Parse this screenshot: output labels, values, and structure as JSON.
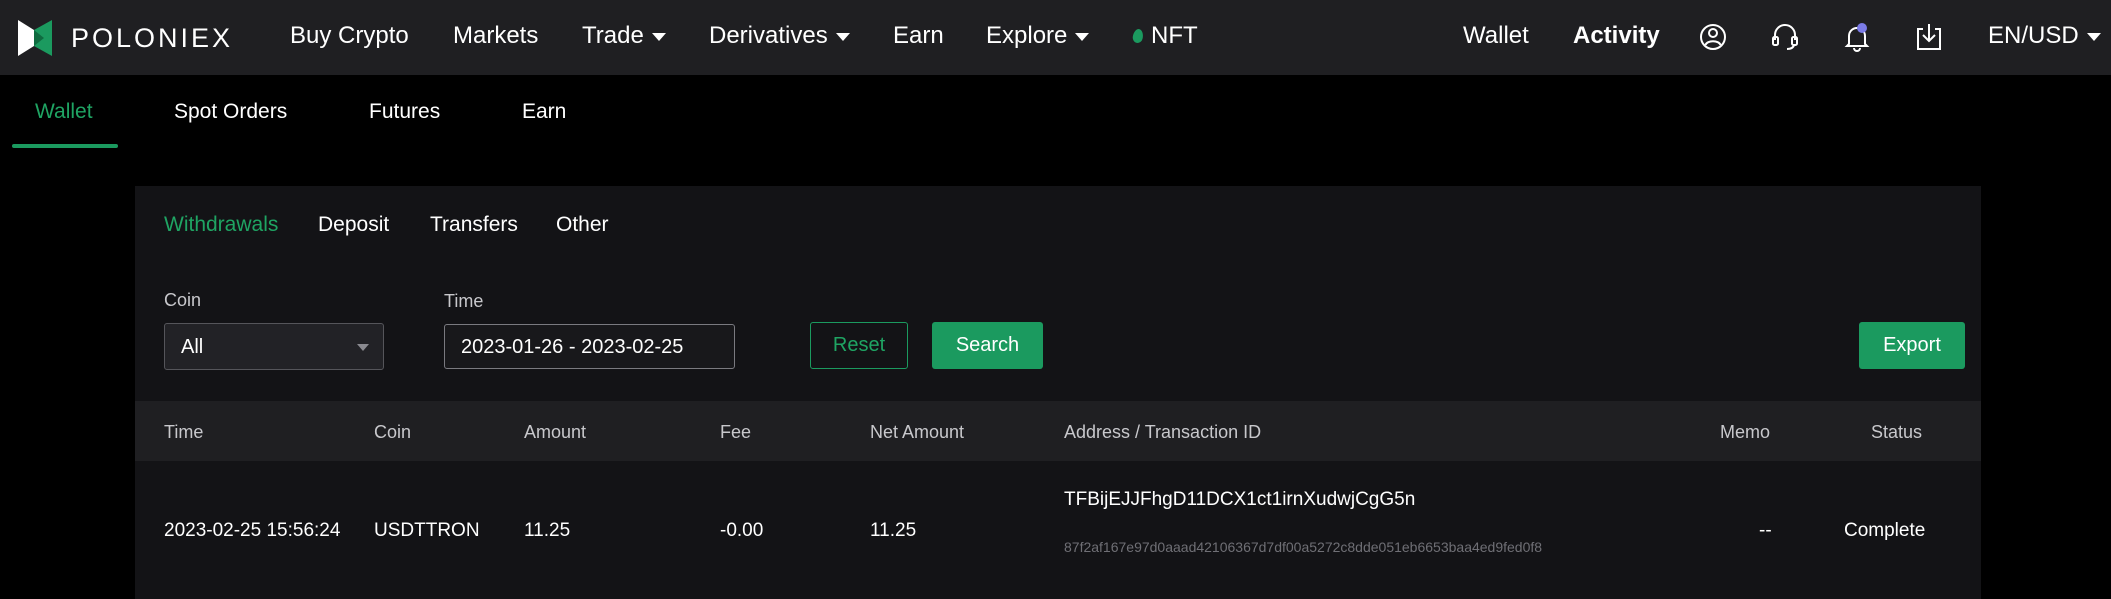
{
  "brand": {
    "name": "POLONIEX"
  },
  "topnav": {
    "items": [
      {
        "label": "Buy Crypto",
        "caret": false
      },
      {
        "label": "Markets",
        "caret": false
      },
      {
        "label": "Trade",
        "caret": true
      },
      {
        "label": "Derivatives",
        "caret": true
      },
      {
        "label": "Earn",
        "caret": false
      },
      {
        "label": "Explore",
        "caret": true
      },
      {
        "label": "NFT",
        "caret": false
      }
    ],
    "wallet": "Wallet",
    "activity": "Activity",
    "locale": "EN/USD",
    "icons": [
      "user-icon",
      "headset-icon",
      "bell-icon",
      "download-icon"
    ],
    "accent": "#1b9a5f"
  },
  "subnav": {
    "items": [
      "Wallet",
      "Spot Orders",
      "Futures",
      "Earn"
    ],
    "active": "Wallet"
  },
  "tabs": {
    "items": [
      "Withdrawals",
      "Deposit",
      "Transfers",
      "Other"
    ],
    "active": "Withdrawals"
  },
  "filters": {
    "coin_label": "Coin",
    "coin_value": "All",
    "time_label": "Time",
    "time_value": "2023-01-26 - 2023-02-25",
    "reset": "Reset",
    "search": "Search",
    "export": "Export"
  },
  "table": {
    "columns": [
      "Time",
      "Coin",
      "Amount",
      "Fee",
      "Net Amount",
      "Address / Transaction ID",
      "Memo",
      "Status"
    ],
    "rows": [
      {
        "time": "2023-02-25 15:56:24",
        "coin": "USDTTRON",
        "amount": "11.25",
        "fee": "-0.00",
        "net_amount": "11.25",
        "address": "TFBijEJJFhgD11DCX1ct1irnXudwjCgG5n",
        "txid": "87f2af167e97d0aaad42106367d7df00a5272c8dde051eb6653baa4ed9fed0f8",
        "memo": "--",
        "status": "Complete"
      }
    ]
  }
}
